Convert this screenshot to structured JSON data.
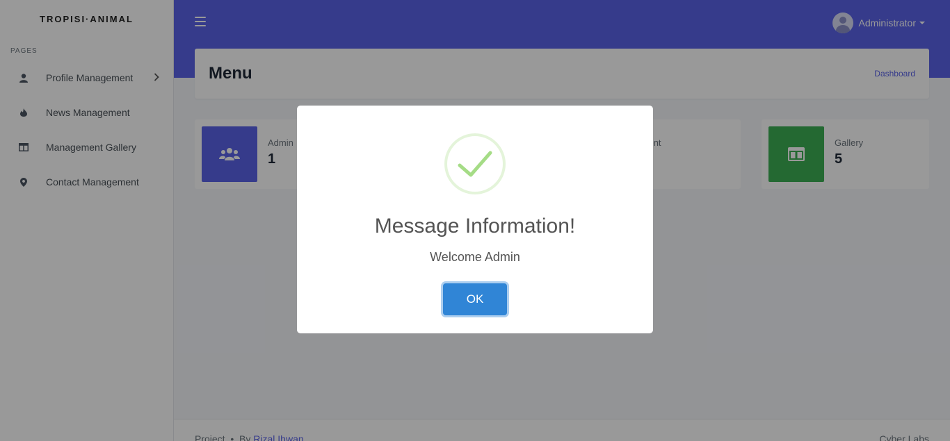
{
  "brand": "TROPISI·ANIMAL",
  "sidebar": {
    "section_title": "PAGES",
    "items": [
      {
        "label": "Profile Management",
        "icon": "user-icon"
      },
      {
        "label": "News Management",
        "icon": "fire-icon"
      },
      {
        "label": "Management Gallery",
        "icon": "gallery-icon"
      },
      {
        "label": "Contact Management",
        "icon": "map-marker-icon"
      }
    ]
  },
  "header": {
    "user_name": "Administrator"
  },
  "page": {
    "title": "Menu",
    "breadcrumb": "Dashboard"
  },
  "stats": [
    {
      "label": "Admin",
      "value": "1",
      "color": "#5a63e8",
      "icon": "users-icon"
    },
    {
      "label": "Content",
      "value": "",
      "color": "#f59e0b",
      "icon": "content-icon"
    },
    {
      "label": "Gallery",
      "value": "5",
      "color": "#3db054",
      "icon": "gallery-icon"
    }
  ],
  "footer": {
    "project": "Project",
    "by": "By",
    "author": "Rizal Ihwan",
    "right": "Cyber Labs"
  },
  "modal": {
    "title": "Message Information!",
    "text": "Welcome Admin",
    "button": "OK"
  },
  "colors": {
    "header": "#5a63e8",
    "success_check": "#a5dc86",
    "ok_button": "#3085d6"
  }
}
